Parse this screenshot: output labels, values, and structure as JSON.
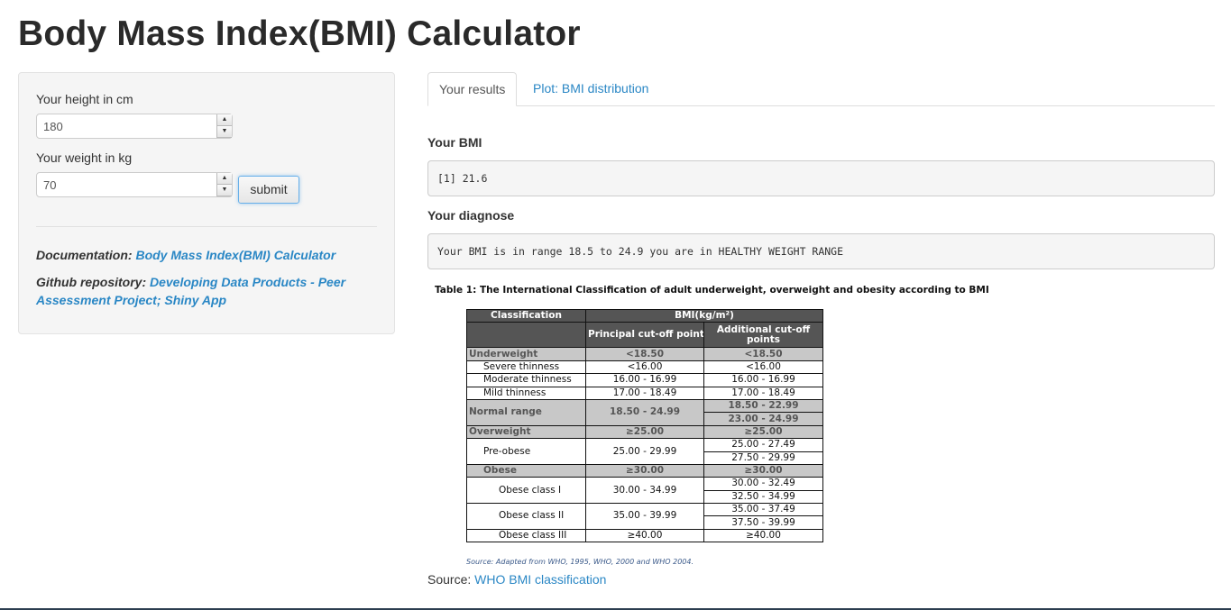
{
  "page": {
    "title": "Body Mass Index(BMI) Calculator"
  },
  "sidebar": {
    "height_label": "Your height in cm",
    "height_value": "180",
    "weight_label": "Your weight in kg",
    "weight_value": "70",
    "submit_label": "submit",
    "documentation_prefix": "Documentation: ",
    "documentation_link": "Body Mass Index(BMI) Calculator",
    "github_prefix": "Github repository: ",
    "github_link": "Developing Data Products - Peer Assessment Project; Shiny App"
  },
  "tabs": [
    {
      "label": "Your results",
      "active": true
    },
    {
      "label": "Plot: BMI distribution",
      "active": false
    }
  ],
  "results": {
    "bmi_heading": "Your BMI",
    "bmi_output": "[1] 21.6",
    "diagnose_heading": "Your diagnose",
    "diagnose_output": "Your BMI is in range 18.5 to 24.9 you are in HEALTHY WEIGHT RANGE"
  },
  "who_table": {
    "caption": "Table 1: The International Classification of adult underweight, overweight and obesity according to BMI",
    "header": {
      "classification": "Classification",
      "bmi": "BMI(kg/m²)",
      "principal": "Principal cut-off points",
      "additional": "Additional cut-off points"
    },
    "rows": {
      "underweight": {
        "label": "Underweight",
        "principal": "<18.50",
        "additional": "<18.50"
      },
      "severe": {
        "label": "Severe thinness",
        "principal": "<16.00",
        "additional": "<16.00"
      },
      "moderate": {
        "label": "Moderate thinness",
        "principal": "16.00 - 16.99",
        "additional": "16.00 - 16.99"
      },
      "mild": {
        "label": "Mild thinness",
        "principal": "17.00 - 18.49",
        "additional": "17.00 - 18.49"
      },
      "normal": {
        "label": "Normal range",
        "principal": "18.50 - 24.99",
        "additional_a": "18.50 - 22.99",
        "additional_b": "23.00 - 24.99"
      },
      "overweight": {
        "label": "Overweight",
        "principal": "≥25.00",
        "additional": "≥25.00"
      },
      "preobese": {
        "label": "Pre-obese",
        "principal": "25.00 - 29.99",
        "additional_a": "25.00 - 27.49",
        "additional_b": "27.50 - 29.99"
      },
      "obese": {
        "label": "Obese",
        "principal": "≥30.00",
        "additional": "≥30.00"
      },
      "obese1": {
        "label": "Obese class I",
        "principal": "30.00 - 34.99",
        "additional_a": "30.00 - 32.49",
        "additional_b": "32.50 - 34.99"
      },
      "obese2": {
        "label": "Obese class II",
        "principal": "35.00 - 39.99",
        "additional_a": "35.00 - 37.49",
        "additional_b": "37.50 - 39.99"
      },
      "obese3": {
        "label": "Obese class III",
        "principal": "≥40.00",
        "additional": "≥40.00"
      }
    },
    "source_note": "Source: Adapted from WHO, 1995, WHO, 2000 and WHO 2004."
  },
  "source": {
    "prefix": "Source: ",
    "link": "WHO BMI classification"
  },
  "colors": {
    "link": "#2a87c5",
    "sidebar_bg": "#f5f5f5",
    "table_header": "#555555",
    "table_grey": "#c8c8c8"
  }
}
